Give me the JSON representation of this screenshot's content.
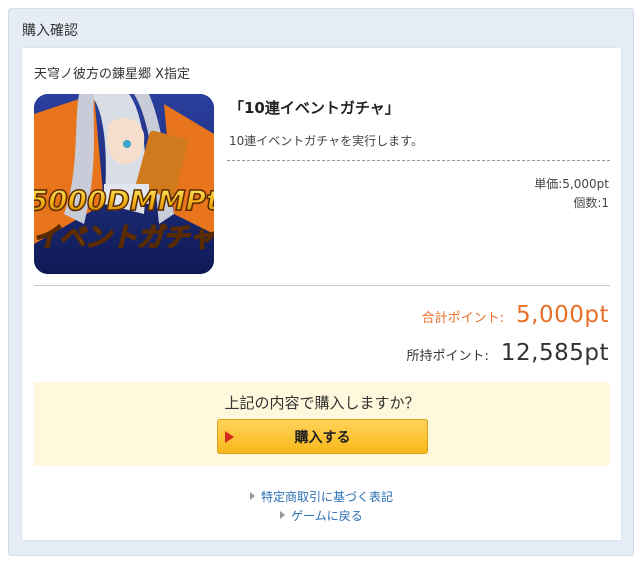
{
  "dialog": {
    "title": "購入確認"
  },
  "game": {
    "title": "天穹ノ彼方の錬星郷 X指定"
  },
  "item": {
    "name": "「10連イベントガチャ」",
    "description": "10連イベントガチャを実行します。",
    "unit_price": "単価:5,000pt",
    "quantity": "個数:1",
    "thumbnail": {
      "icon": "gacha-banner-image",
      "line1": "5000DMMPt",
      "line2": "イベントガチャ"
    }
  },
  "summary": {
    "total_label": "合計ポイント:",
    "total_value": "5,000pt",
    "owned_label": "所持ポイント:",
    "owned_value": "12,585pt"
  },
  "confirm": {
    "question": "上記の内容で購入しますか？",
    "buy_label": "購入する"
  },
  "links": {
    "legal": "特定商取引に基づく表記",
    "back": "ゲームに戻る"
  },
  "colors": {
    "accent_orange": "#e8702a",
    "button_yellow": "#f8b819",
    "link_blue": "#2a6db5",
    "confirm_bg": "#fff8dc"
  }
}
